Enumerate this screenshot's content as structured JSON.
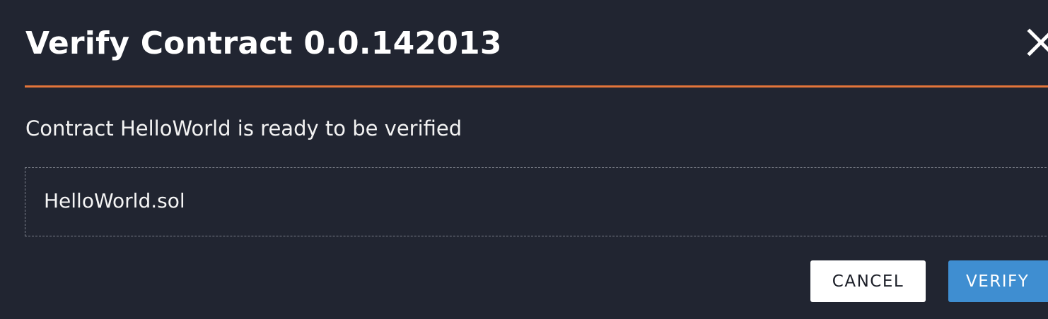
{
  "dialog": {
    "title": "Verify Contract 0.0.142013",
    "close_icon": "close-icon",
    "message": "Contract HelloWorld is ready to be verified",
    "file": {
      "name": "HelloWorld.sol"
    },
    "buttons": {
      "cancel_label": "CANCEL",
      "verify_label": "VERIFY"
    }
  },
  "colors": {
    "background": "#212531",
    "accent_rule": "#e4753a",
    "primary_button": "#3f8ed1",
    "secondary_button": "#ffffff",
    "dashed_border": "#7d818b"
  }
}
